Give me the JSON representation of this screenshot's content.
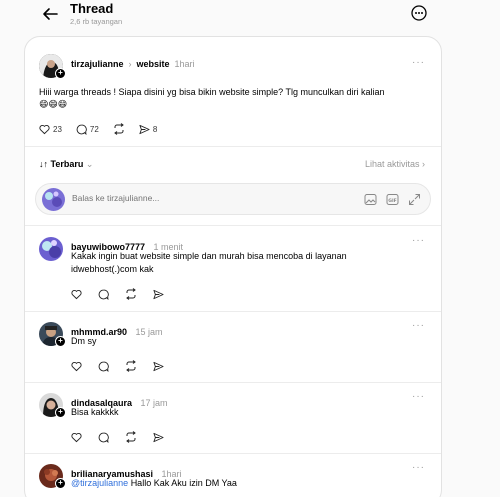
{
  "header": {
    "title": "Thread",
    "subtitle": "2,6 rb tayangan"
  },
  "post": {
    "username": "tirzajulianne",
    "community": "website",
    "time": "1hari",
    "text": "Hiii warga threads ! Siapa disini yg bisa bikin website simple? Tlg munculkan diri kalian",
    "emojis": "😄😄😄",
    "likes": "23",
    "comments": "72",
    "shares": "8"
  },
  "sort": {
    "label": "Terbaru",
    "activity_link": "Lihat aktivitas"
  },
  "reply": {
    "placeholder": "Balas ke tirzajulianne..."
  },
  "comments": [
    {
      "username": "bayuwibowo7777",
      "time": "1 menit",
      "text_line1": "Kakak ingin buat website simple dan murah bisa mencoba di layanan",
      "text_line2": "idwebhost(.)com kak"
    },
    {
      "username": "mhmmd.ar90",
      "time": "15 jam",
      "text_line1": "Dm sy"
    },
    {
      "username": "dindasalqaura",
      "time": "17 jam",
      "text_line1": "Bisa kakkkk"
    },
    {
      "username": "brilianaryamushasi",
      "time": "1hari",
      "mention": "@tirzajulianne",
      "text_line1": "Hallo Kak Aku izin DM Yaa"
    }
  ]
}
